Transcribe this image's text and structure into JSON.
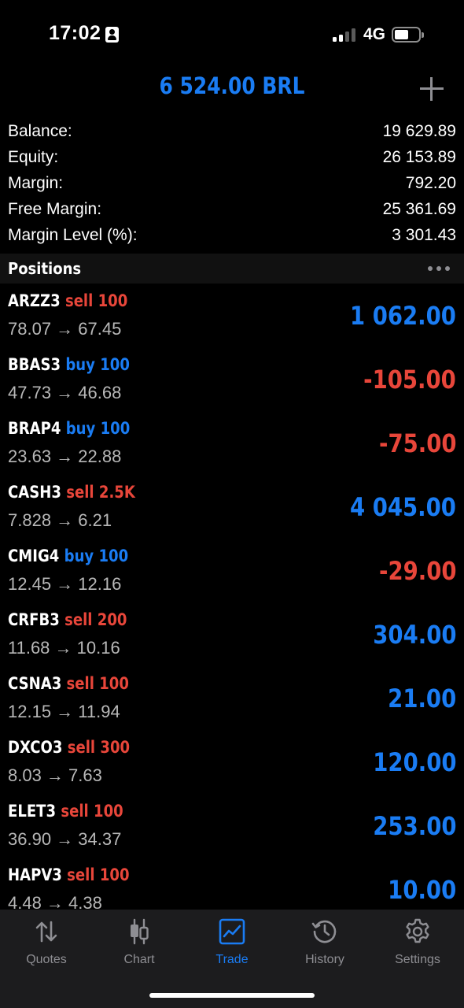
{
  "status_bar": {
    "time": "17:02",
    "network": "4G"
  },
  "header": {
    "title": "6 524.00 BRL",
    "add_icon": "plus-icon"
  },
  "summary": [
    {
      "label": "Balance:",
      "value": "19 629.89"
    },
    {
      "label": "Equity:",
      "value": "26 153.89"
    },
    {
      "label": "Margin:",
      "value": "792.20"
    },
    {
      "label": "Free Margin:",
      "value": "25 361.69"
    },
    {
      "label": "Margin Level (%):",
      "value": "3 301.43"
    }
  ],
  "positions": {
    "title": "Positions",
    "items": [
      {
        "symbol": "ARZZ3",
        "side": "sell 100",
        "prices": "78.07 → 67.45",
        "profit": "1 062.00"
      },
      {
        "symbol": "BBAS3",
        "side": "buy 100",
        "prices": "47.73 → 46.68",
        "profit": "-105.00"
      },
      {
        "symbol": "BRAP4",
        "side": "buy 100",
        "prices": "23.63 → 22.88",
        "profit": "-75.00"
      },
      {
        "symbol": "CASH3",
        "side": "sell 2.5K",
        "prices": "7.828 → 6.21",
        "profit": "4 045.00"
      },
      {
        "symbol": "CMIG4",
        "side": "buy 100",
        "prices": "12.45 → 12.16",
        "profit": "-29.00"
      },
      {
        "symbol": "CRFB3",
        "side": "sell 200",
        "prices": "11.68 → 10.16",
        "profit": "304.00"
      },
      {
        "symbol": "CSNA3",
        "side": "sell 100",
        "prices": "12.15 → 11.94",
        "profit": "21.00"
      },
      {
        "symbol": "DXCO3",
        "side": "sell 300",
        "prices": "8.03 → 7.63",
        "profit": "120.00"
      },
      {
        "symbol": "ELET3",
        "side": "sell 100",
        "prices": "36.90 → 34.37",
        "profit": "253.00"
      },
      {
        "symbol": "HAPV3",
        "side": "sell 100",
        "prices": "4.48 → 4.38",
        "profit": "10.00"
      }
    ]
  },
  "colors": {
    "accent_blue": "#1a7cf3",
    "loss_red": "#e8463a",
    "tab_bar": "#1c1c1e"
  },
  "tabs": [
    {
      "label": "Quotes",
      "icon": "up-down-arrows-icon",
      "active": false
    },
    {
      "label": "Chart",
      "icon": "candlestick-icon",
      "active": false
    },
    {
      "label": "Trade",
      "icon": "trade-chart-icon",
      "active": true
    },
    {
      "label": "History",
      "icon": "history-clock-icon",
      "active": false
    },
    {
      "label": "Settings",
      "icon": "gear-icon",
      "active": false
    }
  ]
}
